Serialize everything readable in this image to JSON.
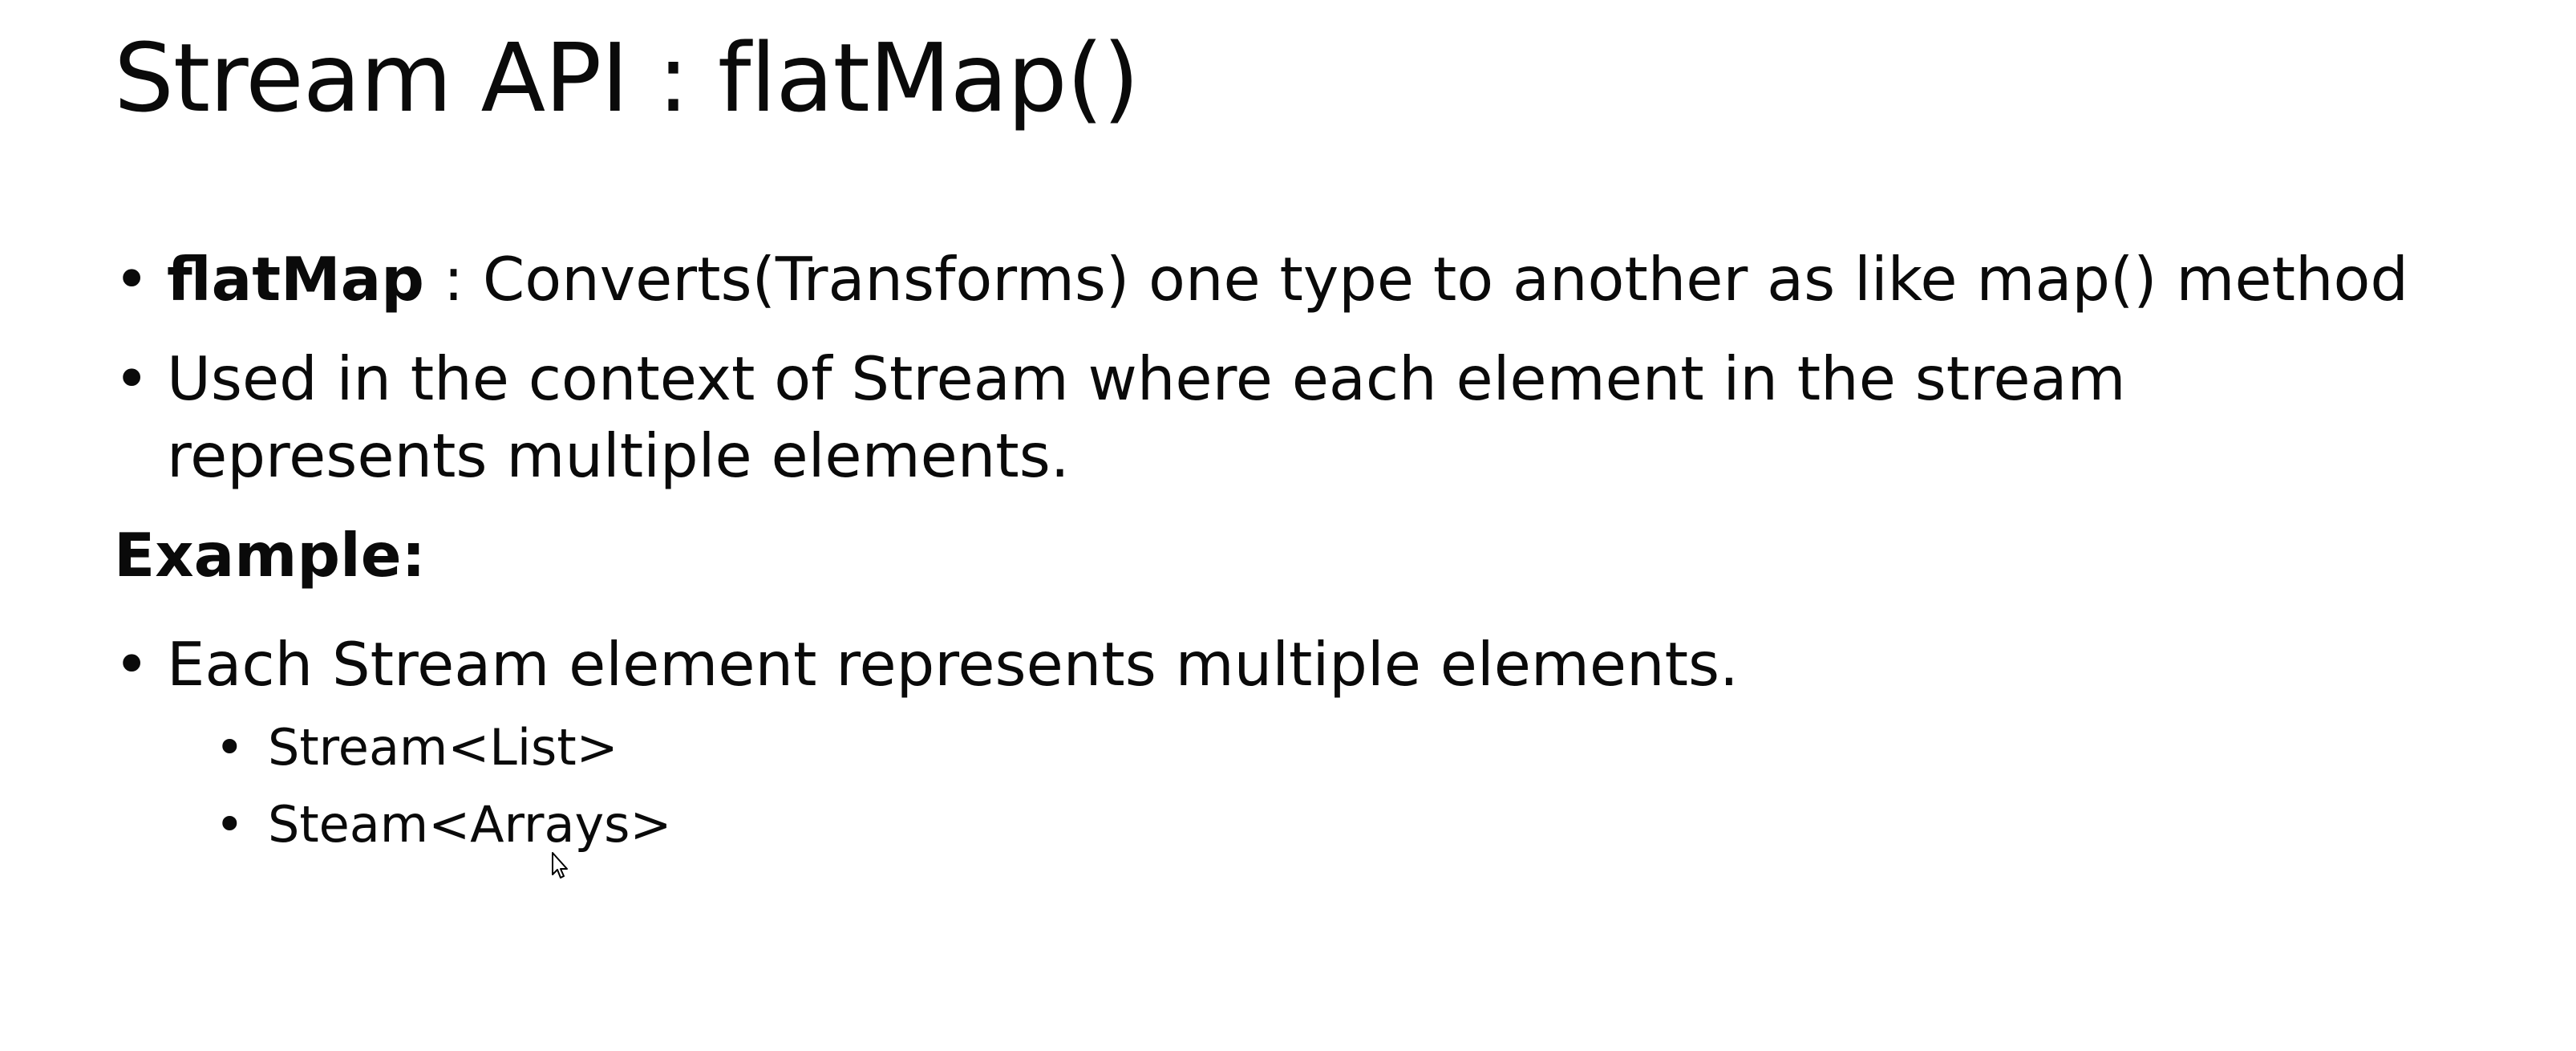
{
  "slide": {
    "title": "Stream API : flatMap()",
    "bullets": [
      {
        "bold": "flatMap",
        "text": " : Converts(Transforms) one type to another as like map() method"
      },
      {
        "text": "Used in the context of Stream where each element in the stream represents multiple elements."
      }
    ],
    "example_heading": "Example:",
    "example_bullet": "Each Stream element represents multiple elements.",
    "sub_bullets": [
      "Stream<List>",
      "Steam<Arrays>"
    ],
    "bullet_char": "•"
  }
}
